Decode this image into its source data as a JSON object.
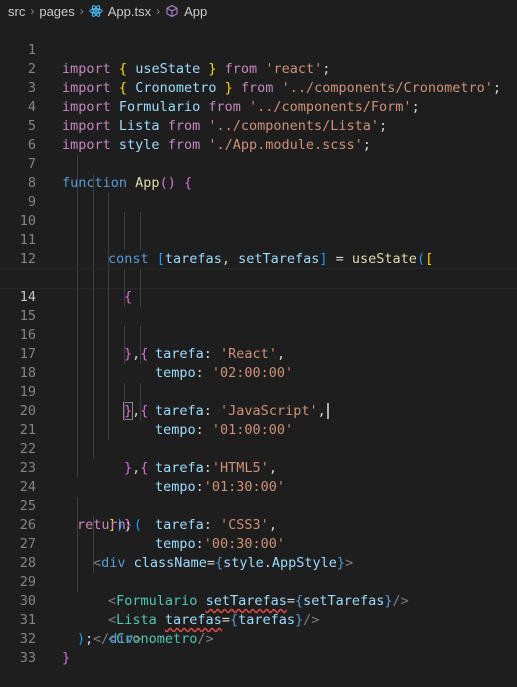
{
  "breadcrumb": {
    "items": [
      "src",
      "pages",
      "App.tsx",
      "App"
    ]
  },
  "colors": {
    "background": "#1e1e1e",
    "keyword": "#569cd6",
    "import": "#c586c0",
    "variable": "#9cdcfe",
    "function": "#dcdcaa",
    "string": "#ce9178",
    "component": "#4ec9b0",
    "line_number": "#858585"
  },
  "editor": {
    "active_line": 14,
    "lines": [
      {
        "n": "1",
        "text": "import { useState } from 'react';"
      },
      {
        "n": "2",
        "text": "import { Cronometro } from '../components/Cronometro';"
      },
      {
        "n": "3",
        "text": "import Formulario from '../components/Form';"
      },
      {
        "n": "4",
        "text": "import Lista from '../components/Lista';"
      },
      {
        "n": "5",
        "text": "import style from './App.module.scss';"
      },
      {
        "n": "6",
        "text": ""
      },
      {
        "n": "7",
        "text": "function App() {"
      },
      {
        "n": "8",
        "text": ""
      },
      {
        "n": "9",
        "text": "const [tarefas, setTarefas] = useState(["
      },
      {
        "n": "10",
        "text": "{"
      },
      {
        "n": "11",
        "text": "tarefa: 'React',"
      },
      {
        "n": "12",
        "text": "tempo: '02:00:00'"
      },
      {
        "n": "13",
        "text": "},{"
      },
      {
        "n": "14",
        "text": "tarefa: 'JavaScript',"
      },
      {
        "n": "15",
        "text": "tempo: '01:00:00'"
      },
      {
        "n": "16",
        "text": "},{"
      },
      {
        "n": "17",
        "text": "tarefa:'HTML5',"
      },
      {
        "n": "18",
        "text": "tempo:'01:30:00'"
      },
      {
        "n": "19",
        "text": "},{"
      },
      {
        "n": "20",
        "text": "tarefa: 'CSS3',"
      },
      {
        "n": "21",
        "text": "tempo:'00:30:00'"
      },
      {
        "n": "22",
        "text": "}"
      },
      {
        "n": "23",
        "text": "]);"
      },
      {
        "n": "24",
        "text": ""
      },
      {
        "n": "25",
        "text": "return ("
      },
      {
        "n": "26",
        "text": "<div className={style.AppStyle}>"
      },
      {
        "n": "27",
        "text": "<Formulario setTarefas={setTarefas}/>"
      },
      {
        "n": "28",
        "text": "<Lista tarefas={tarefas}/>"
      },
      {
        "n": "29",
        "text": "<Cronometro/>"
      },
      {
        "n": "30",
        "text": "</div>"
      },
      {
        "n": "31",
        "text": ");"
      },
      {
        "n": "32",
        "text": "}"
      },
      {
        "n": "33",
        "text": ""
      }
    ]
  }
}
